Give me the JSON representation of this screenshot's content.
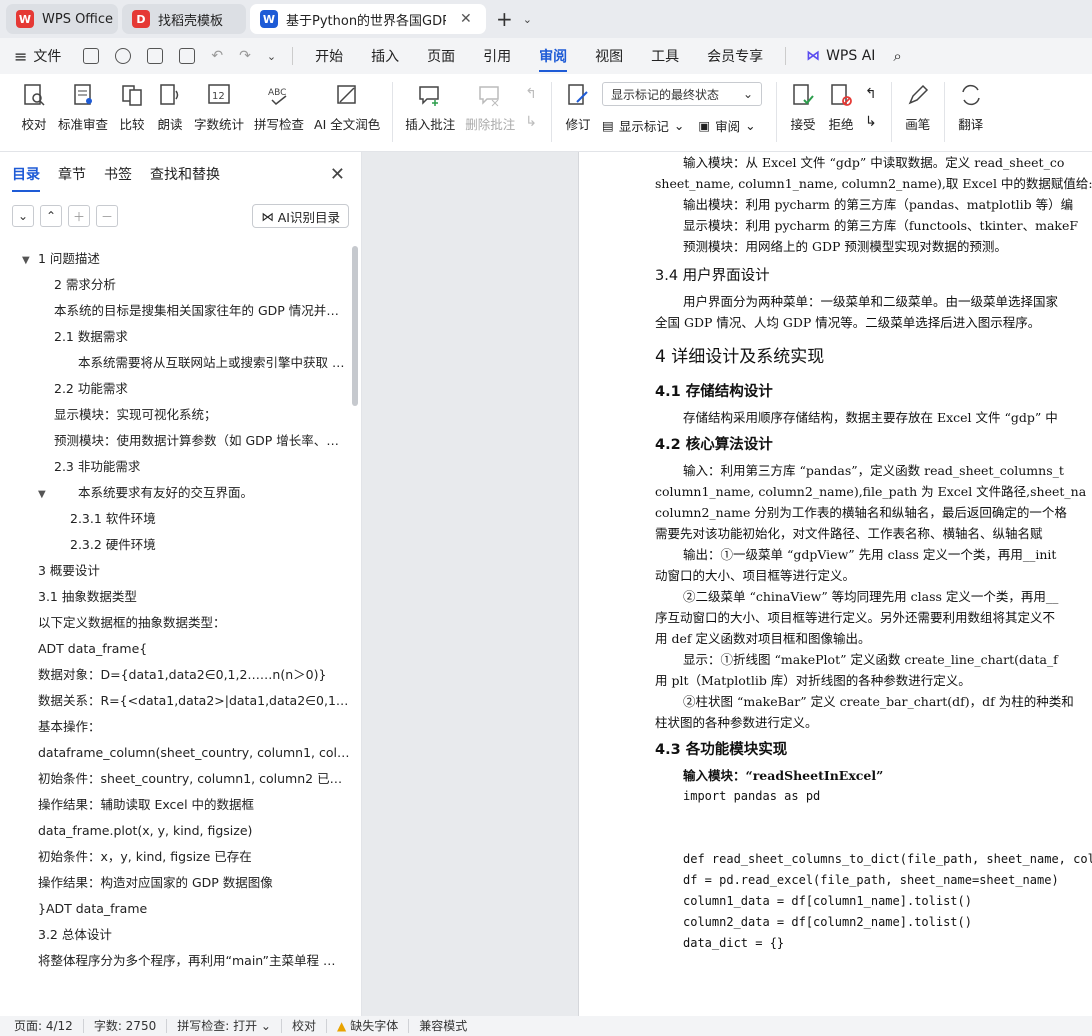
{
  "tabs": [
    {
      "label": "WPS Office",
      "icon": "wps-logo-icon",
      "color": "#e53935"
    },
    {
      "label": "找稻壳模板",
      "icon": "docer-icon",
      "color": "#e53935"
    },
    {
      "label": "基于Python的世界各国GDP和",
      "icon": "writer-icon",
      "color": "#1e5bd6"
    }
  ],
  "menu": {
    "file": "文件",
    "items": [
      "开始",
      "插入",
      "页面",
      "引用",
      "审阅",
      "视图",
      "工具",
      "会员专享"
    ],
    "active": "审阅",
    "wps_ai": "WPS AI"
  },
  "ribbon": {
    "proofread": "校对",
    "std_review": "标准审查",
    "compare": "比较",
    "read_aloud": "朗读",
    "word_count": "字数统计",
    "spell_check": "拼写检查",
    "ai_polish": "AI 全文润色",
    "insert_comment": "插入批注",
    "delete_comment": "删除批注",
    "markup_dropdown": "显示标记的最终状态",
    "revise": "修订",
    "show_markup": "显示标记",
    "review": "审阅",
    "accept": "接受",
    "reject": "拒绝",
    "pen": "画笔",
    "translate": "翻译"
  },
  "left_panel": {
    "tabs": [
      "目录",
      "章节",
      "书签",
      "查找和替换"
    ],
    "ai_toc": "AI识别目录",
    "toc": [
      {
        "text": "1  问题描述",
        "indent": 0,
        "arrow": true
      },
      {
        "text": "2  需求分析",
        "indent": 2
      },
      {
        "text": "本系统的目标是搜集相关国家往年的 GDP 情况并以…",
        "indent": 2
      },
      {
        "text": "2.1  数据需求",
        "indent": 2
      },
      {
        "text": "本系统需要将从互联网站上或搜索引擎中获取 …",
        "indent": 3
      },
      {
        "text": "2.2  功能需求",
        "indent": 2
      },
      {
        "text": "显示模块：实现可视化系统；",
        "indent": 2
      },
      {
        "text": "预测模块：使用数据计算参数（如 GDP 增长率、人…",
        "indent": 2
      },
      {
        "text": "2.3  非功能需求",
        "indent": 2
      },
      {
        "text": "本系统要求有友好的交互界面。",
        "indent": 3,
        "arrow": true
      },
      {
        "text": "2.3.1 软件环境",
        "indent": 4
      },
      {
        "text": "2.3.2 硬件环境",
        "indent": 4
      },
      {
        "text": "3  概要设计",
        "indent": 1
      },
      {
        "text": "3.1 抽象数据类型",
        "indent": 1
      },
      {
        "text": "以下定义数据框的抽象数据类型：",
        "indent": 1
      },
      {
        "text": "ADT data_frame{",
        "indent": 1
      },
      {
        "text": "数据对象：D={data1,data2∈0,1,2……n(n＞0)}",
        "indent": 1
      },
      {
        "text": "数据关系：R={<data1,data2>|data1,data2∈0,1,2… …",
        "indent": 1
      },
      {
        "text": "基本操作：",
        "indent": 1
      },
      {
        "text": "dataframe_column(sheet_country, column1, colum …",
        "indent": 1
      },
      {
        "text": "初始条件：sheet_country, column1, column2 已存在",
        "indent": 1
      },
      {
        "text": "操作结果：辅助读取 Excel 中的数据框",
        "indent": 1
      },
      {
        "text": "data_frame.plot(x, y, kind, figsize)",
        "indent": 1
      },
      {
        "text": "初始条件：x，y, kind, figsize 已存在",
        "indent": 1
      },
      {
        "text": "操作结果：构造对应国家的 GDP 数据图像",
        "indent": 1
      },
      {
        "text": "}ADT data_frame",
        "indent": 1
      },
      {
        "text": "3.2  总体设计",
        "indent": 1
      },
      {
        "text": "将整体程序分为多个程序，再利用“main”主菜单程 …",
        "indent": 1
      }
    ]
  },
  "document": {
    "lines": [
      {
        "cls": "dl ind",
        "text": "输入模块：从 Excel 文件 “gdp” 中读取数据。定义 read_sheet_co"
      },
      {
        "cls": "dl",
        "text": "sheet_name, column1_name, column2_name),取 Excel 中的数据赋值给:"
      },
      {
        "cls": "dl ind",
        "text": "输出模块：利用 pycharm 的第三方库（pandas、matplotlib 等）编"
      },
      {
        "cls": "dl ind",
        "text": "显示模块：利用 pycharm 的第三方库（functools、tkinter、makeF"
      },
      {
        "cls": "dl ind",
        "text": "预测模块：用网络上的 GDP 预测模型实现对数据的预测。"
      },
      {
        "cls": "h3",
        "text": "3.4  用户界面设计"
      },
      {
        "cls": "dl ind",
        "text": "用户界面分为两种菜单：一级菜单和二级菜单。由一级菜单选择国家"
      },
      {
        "cls": "dl",
        "text": "全国 GDP 情况、人均 GDP 情况等。二级菜单选择后进入图示程序。"
      },
      {
        "cls": "h2",
        "text": "4 详细设计及系统实现"
      },
      {
        "cls": "h4",
        "text": "4.1  存储结构设计"
      },
      {
        "cls": "dl ind",
        "text": "存储结构采用顺序存储结构，数据主要存放在 Excel 文件 “gdp” 中"
      },
      {
        "cls": "h4",
        "text": "4.2  核心算法设计"
      },
      {
        "cls": "dl ind",
        "text": "输入：利用第三方库 “pandas”，定义函数 read_sheet_columns_t"
      },
      {
        "cls": "dl",
        "text": "column1_name, column2_name),file_path 为 Excel 文件路径,sheet_na"
      },
      {
        "cls": "dl",
        "text": "column2_name 分别为工作表的横轴名和纵轴名，最后返回确定的一个格"
      },
      {
        "cls": "dl",
        "text": "需要先对该功能初始化，对文件路径、工作表名称、横轴名、纵轴名赋"
      },
      {
        "cls": "dl ind",
        "text": "输出：①一级菜单 “gdpView” 先用 class 定义一个类，再用__init"
      },
      {
        "cls": "dl",
        "text": "动窗口的大小、项目框等进行定义。"
      },
      {
        "cls": "dl ind",
        "text": "②二级菜单 “chinaView” 等均同理先用 class 定义一个类，再用__"
      },
      {
        "cls": "dl",
        "text": "序互动窗口的大小、项目框等进行定义。另外还需要利用数组将其定义不"
      },
      {
        "cls": "dl",
        "text": "用 def 定义函数对项目框和图像输出。"
      },
      {
        "cls": "dl ind",
        "text": "显示：①折线图 “makePlot” 定义函数 create_line_chart(data_f"
      },
      {
        "cls": "dl",
        "text": "用 plt（Matplotlib 库）对折线图的各种参数进行定义。"
      },
      {
        "cls": "dl ind",
        "text": "②柱状图 “makeBar” 定义 create_bar_chart(df)，df 为柱的种类和"
      },
      {
        "cls": "dl",
        "text": "柱状图的各种参数进行定义。"
      },
      {
        "cls": "h4",
        "text": "4.3  各功能模块实现"
      },
      {
        "cls": "dl ind bold",
        "text": "输入模块：“readSheetInExcel”"
      },
      {
        "cls": "dl ind code",
        "text": "import pandas as pd"
      },
      {
        "cls": "dl",
        "text": ""
      },
      {
        "cls": "dl",
        "text": ""
      },
      {
        "cls": "dl ind code",
        "text": "def read_sheet_columns_to_dict(file_path, sheet_name, colum"
      },
      {
        "cls": "dl ind code",
        "text": "    df = pd.read_excel(file_path, sheet_name=sheet_name)"
      },
      {
        "cls": "dl ind code",
        "text": "    column1_data = df[column1_name].tolist()"
      },
      {
        "cls": "dl ind code",
        "text": "    column2_data = df[column2_name].tolist()"
      },
      {
        "cls": "dl ind code",
        "text": "    data_dict = {}"
      }
    ]
  },
  "status": {
    "page": "页面: 4/12",
    "words": "字数: 2750",
    "spell": "拼写检查: 打开 ⌄",
    "proof": "校对",
    "missing_font": "缺失字体",
    "compat": "兼容模式"
  }
}
